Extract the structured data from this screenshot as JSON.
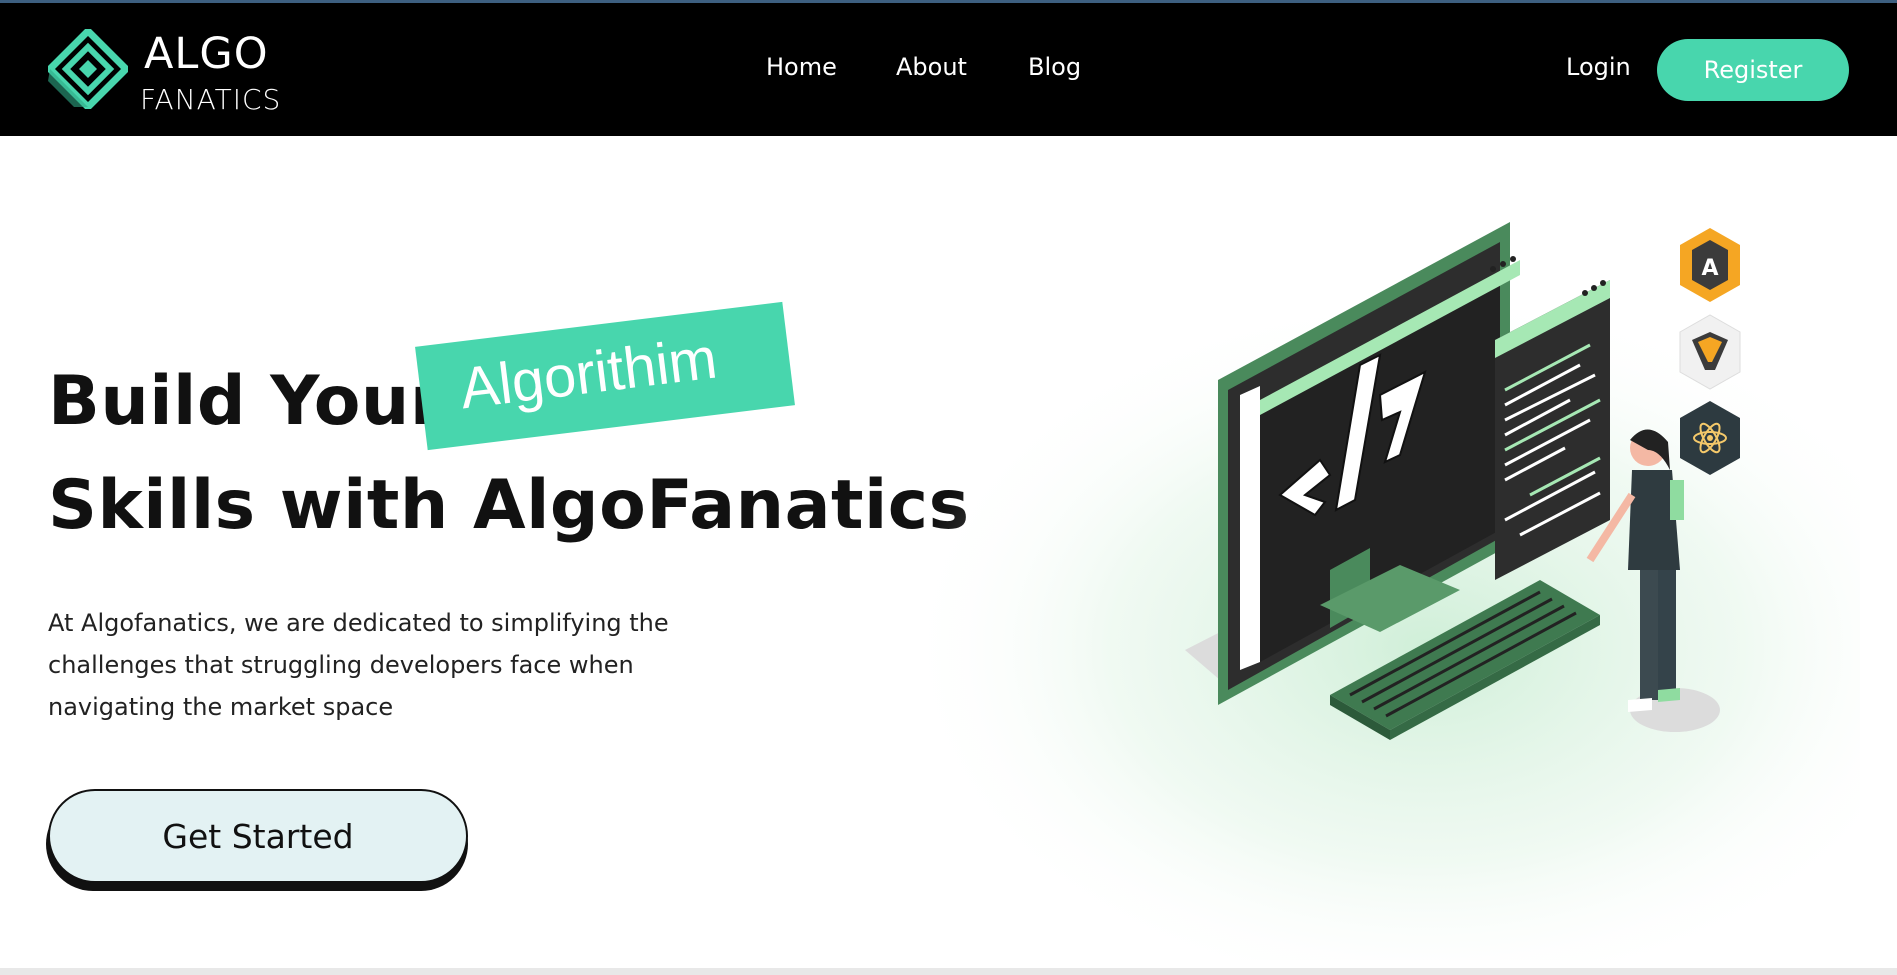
{
  "logo": {
    "line1": "ALGO",
    "line2": "FANATICS",
    "icon": "diamond-logo-icon"
  },
  "nav": {
    "items": [
      {
        "label": "Home"
      },
      {
        "label": "About"
      },
      {
        "label": "Blog"
      }
    ],
    "login_label": "Login",
    "register_label": "Register"
  },
  "hero": {
    "title_line1": "Build Your",
    "highlight_word": "Algorithim",
    "title_line2": "Skills with AlgoFanatics",
    "description": "At Algofanatics, we are dedicated to simplifying the challenges that struggling developers face when navigating the market space",
    "cta_label": "Get Started"
  },
  "illustration": {
    "icons": [
      "angular-icon",
      "vue-icon",
      "react-icon"
    ],
    "code_symbol": "</>"
  },
  "colors": {
    "accent": "#48d6ad",
    "navbar_bg": "#000000",
    "cta_bg": "#e3f2f3",
    "illustration_green": "#5a9a6a"
  }
}
